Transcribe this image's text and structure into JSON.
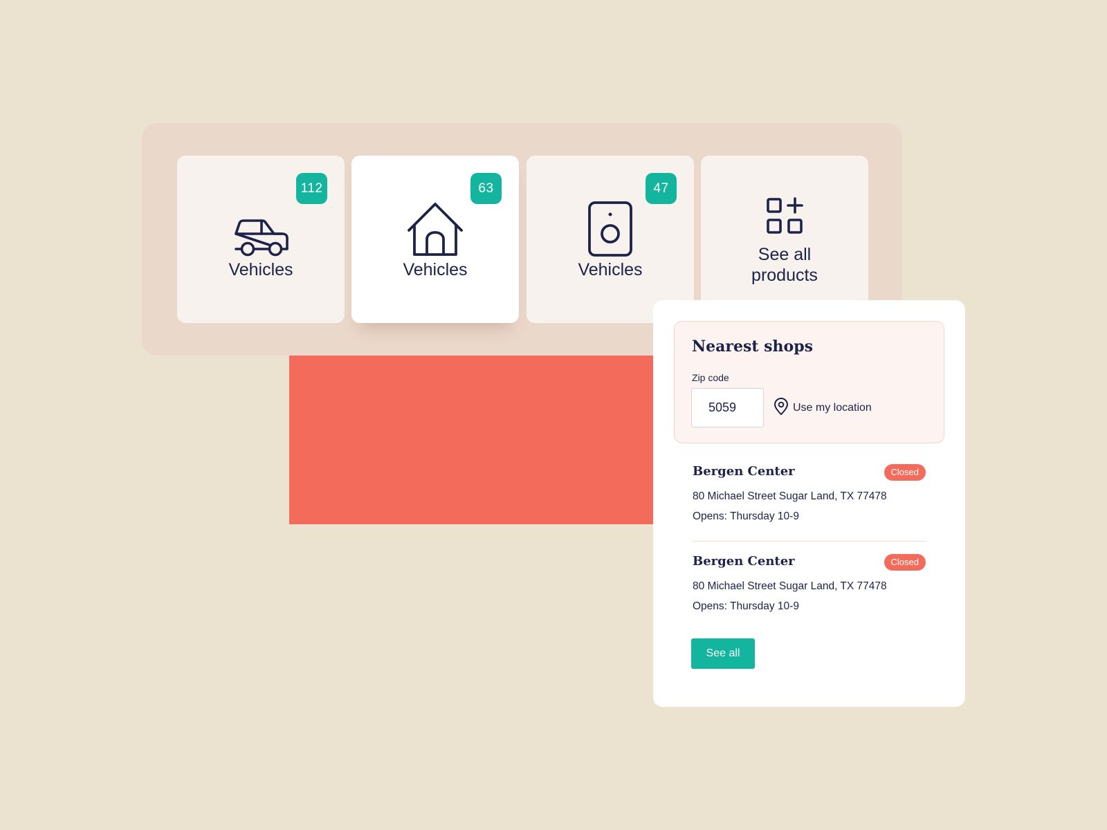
{
  "colors": {
    "background": "#EBE3D0",
    "panel": "#EAD8CA",
    "card": "#F7F2EE",
    "card_active": "#FFFFFF",
    "accent_teal": "#14B59E",
    "accent_coral": "#F26B5B",
    "text_navy": "#1C2248"
  },
  "categories": [
    {
      "label": "Vehicles",
      "count": "112",
      "icon": "car-icon",
      "active": false
    },
    {
      "label": "Vehicles",
      "count": "63",
      "icon": "house-icon",
      "active": true
    },
    {
      "label": "Vehicles",
      "count": "47",
      "icon": "speaker-icon",
      "active": false
    },
    {
      "label_line1": "See all",
      "label_line2": "products",
      "icon": "grid-plus-icon",
      "active": false
    }
  ],
  "shops_panel": {
    "title": "Nearest shops",
    "zip_label": "Zip code",
    "zip_value": "5059",
    "location_label": "Use my location",
    "location_icon": "map-pin-icon",
    "shops": [
      {
        "name": "Bergen Center",
        "status": "Closed",
        "address": "80 Michael Street Sugar Land, TX 77478",
        "hours": "Opens: Thursday 10-9"
      },
      {
        "name": "Bergen Center",
        "status": "Closed",
        "address": "80 Michael Street Sugar Land, TX 77478",
        "hours": "Opens: Thursday 10-9"
      }
    ],
    "see_all_label": "See all"
  }
}
